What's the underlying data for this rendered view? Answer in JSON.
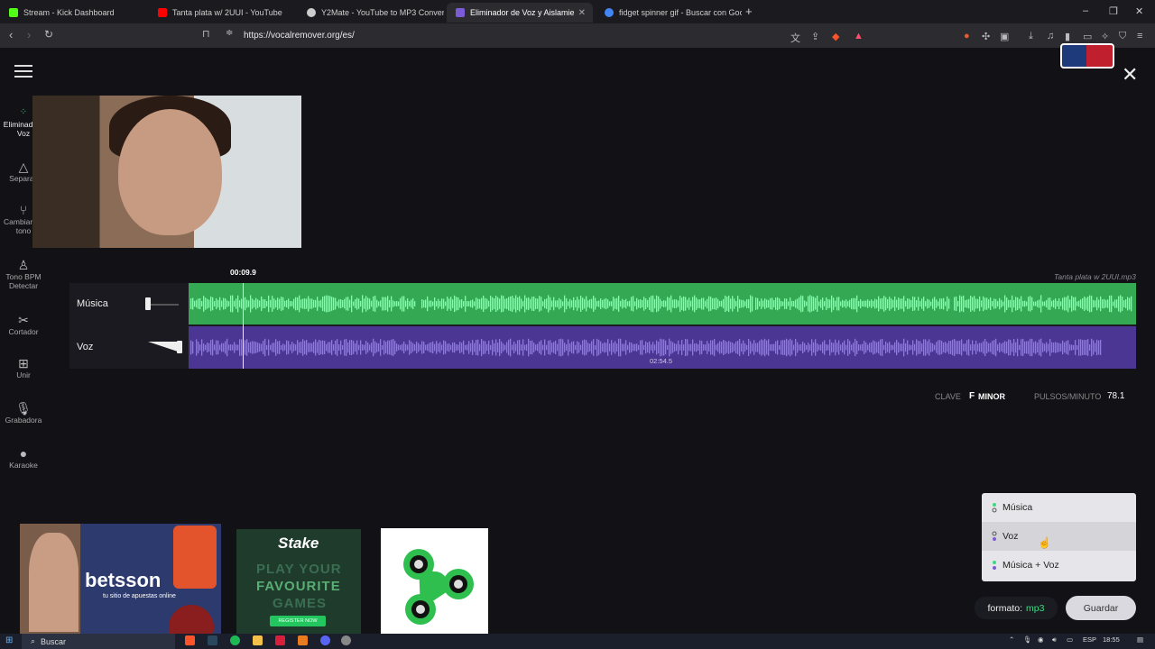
{
  "tabs": [
    {
      "title": "Stream - Kick Dashboard",
      "color": "#53fc18"
    },
    {
      "title": "Tanta plata w/ 2UUI - YouTube",
      "color": "#ff0000"
    },
    {
      "title": "Y2Mate - YouTube to MP3 Converter",
      "color": "#cccccc"
    },
    {
      "title": "Eliminador de Voz y Aislamie",
      "color": "#7b5cd6"
    },
    {
      "title": "fidget spinner gif - Buscar con Google",
      "color": "#4285f4"
    }
  ],
  "address": {
    "url": "https://vocalremover.org/es/"
  },
  "sidebar": [
    {
      "label": "Eliminad de Voz",
      "icon": "vocal-remover-icon"
    },
    {
      "label": "Separac",
      "icon": "splitter-icon"
    },
    {
      "label": "Cambiar de tono",
      "icon": "pitch-icon"
    },
    {
      "label": "Tono BPM Detectar",
      "icon": "bpm-icon"
    },
    {
      "label": "Cortador",
      "icon": "cutter-icon"
    },
    {
      "label": "Unir",
      "icon": "joiner-icon"
    },
    {
      "label": "Grabadora",
      "icon": "mic-icon"
    },
    {
      "label": "Karaoke",
      "icon": "karaoke-icon"
    }
  ],
  "player": {
    "time": "00:09.9",
    "filename": "Tanta plata w 2UUI.mp3",
    "duration": "02:54.5",
    "tracks": [
      {
        "label": "Música",
        "volume": 0.0,
        "color": "#34a853"
      },
      {
        "label": "Voz",
        "volume": 1.0,
        "color": "#4b3793"
      }
    ],
    "playhead_fraction": 0.057
  },
  "analysis": {
    "key_label": "CLAVE",
    "key_note": "F",
    "key_mode": "MINOR",
    "bpm_label": "PULSOS/MINUTO",
    "bpm_value": "78.1"
  },
  "dropdown": {
    "items": [
      "Música",
      "Voz",
      "Música + Voz"
    ],
    "highlighted": 1
  },
  "export": {
    "format_label": "formato:",
    "format_value": "mp3",
    "save_label": "Guardar"
  },
  "ads": {
    "betsson": {
      "brand": "betsson",
      "tagline": "tu sitio de apuestas online"
    },
    "stake": {
      "logo": "Stake",
      "lines": [
        "PLAY YOUR",
        "FAVOURITE",
        "GAMES"
      ],
      "button": "REGISTER NOW"
    }
  },
  "taskbar": {
    "search": "Buscar",
    "lang": "ESP",
    "clock": "18:55"
  }
}
